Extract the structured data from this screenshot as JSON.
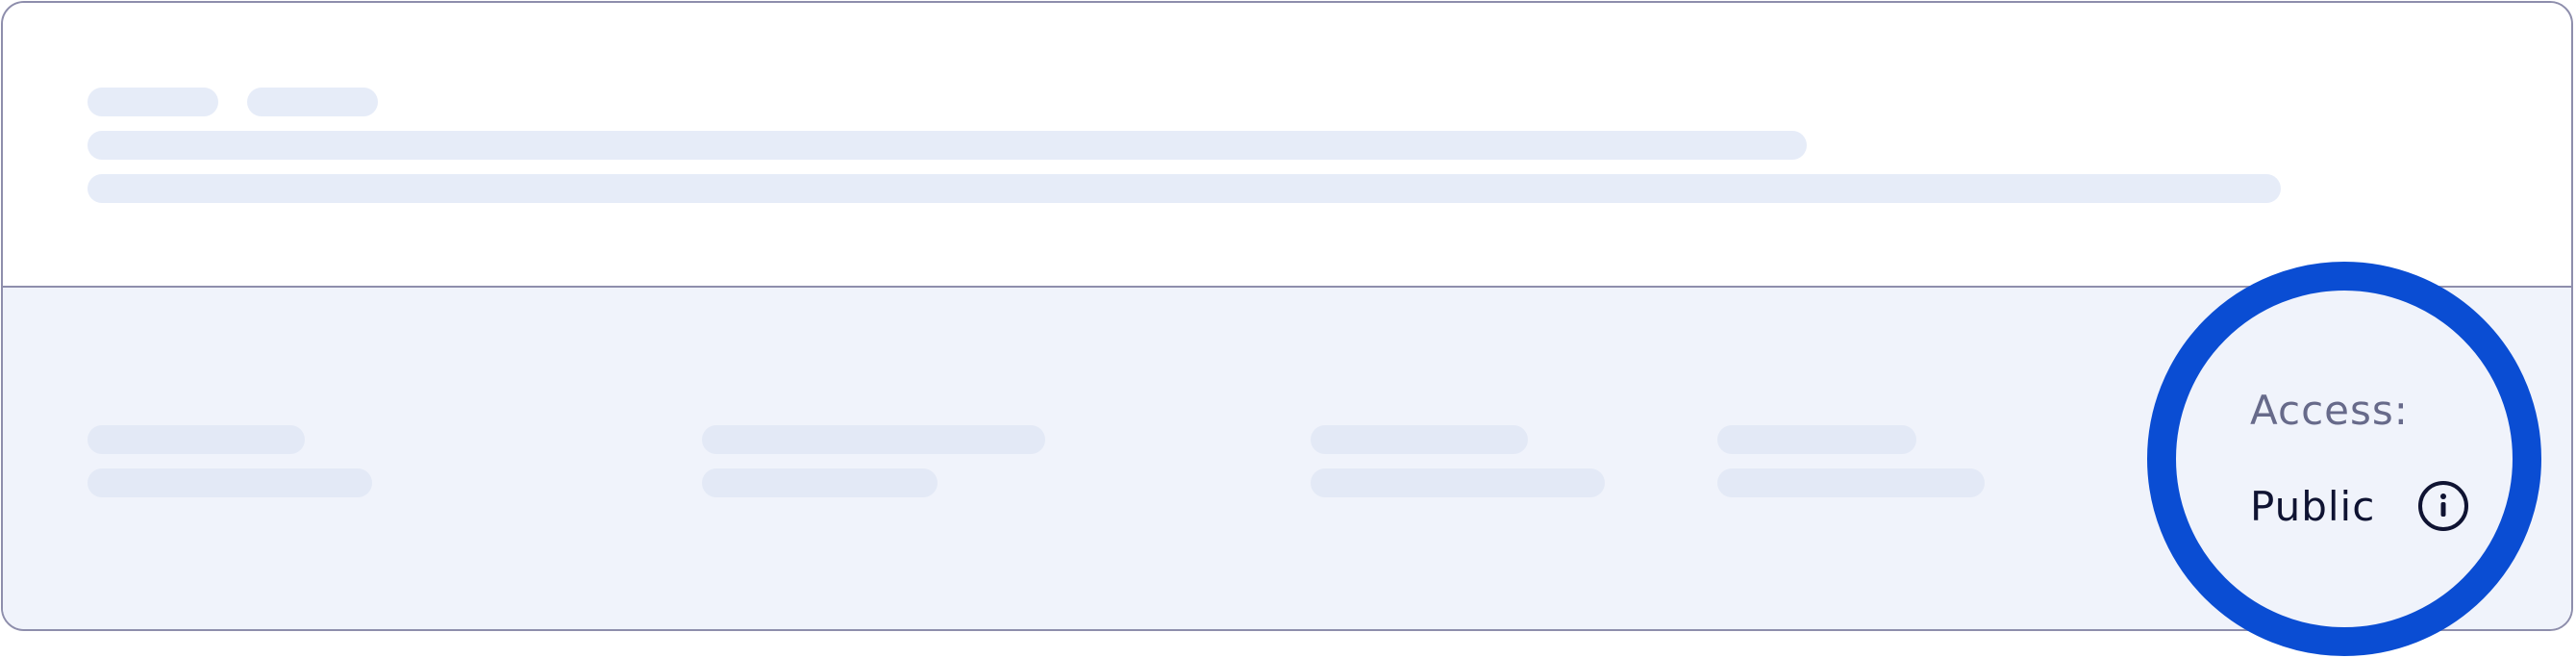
{
  "access_panel": {
    "label": "Access:",
    "value": "Public",
    "info_icon": "info-icon"
  },
  "colors": {
    "border": "#8e8eac",
    "skeleton": "#e6ecf8",
    "bottom_background": "#f0f3fb",
    "highlight_ring": "#0a4dd3",
    "label_text": "#676a8a",
    "value_text": "#0f1332"
  }
}
